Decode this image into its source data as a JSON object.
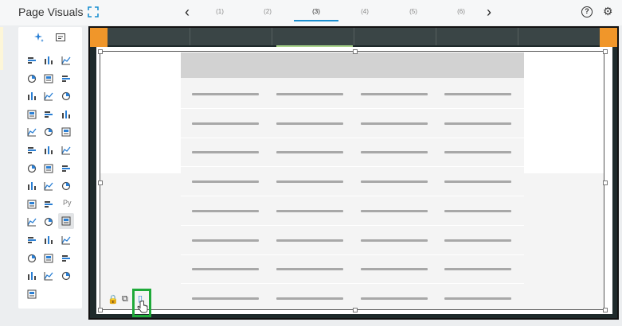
{
  "header": {
    "title": "Page Visuals",
    "tabs": [
      {
        "label": "(1)",
        "active": false
      },
      {
        "label": "(2)",
        "active": false
      },
      {
        "label": "(3)",
        "active": true
      },
      {
        "label": "(4)",
        "active": false
      },
      {
        "label": "(5)",
        "active": false
      },
      {
        "label": "(6)",
        "active": false
      }
    ],
    "prev_arrow": "‹",
    "next_arrow": "›",
    "help_label": "?",
    "settings_glyph": "⚙"
  },
  "palette": {
    "top_icons": [
      "sparkle-icon",
      "smart-narrative-icon"
    ],
    "python_label": "Py",
    "selected_icon": "table-icon"
  },
  "canvas": {
    "accent_color": "#f0962a",
    "highlight_color": "#1faa3a",
    "table_columns": 4,
    "table_rows": 8
  },
  "visual_toolbar": {
    "lock_glyph": "🔒",
    "copy_glyph": "⧉",
    "mobile_glyph": "▯"
  }
}
